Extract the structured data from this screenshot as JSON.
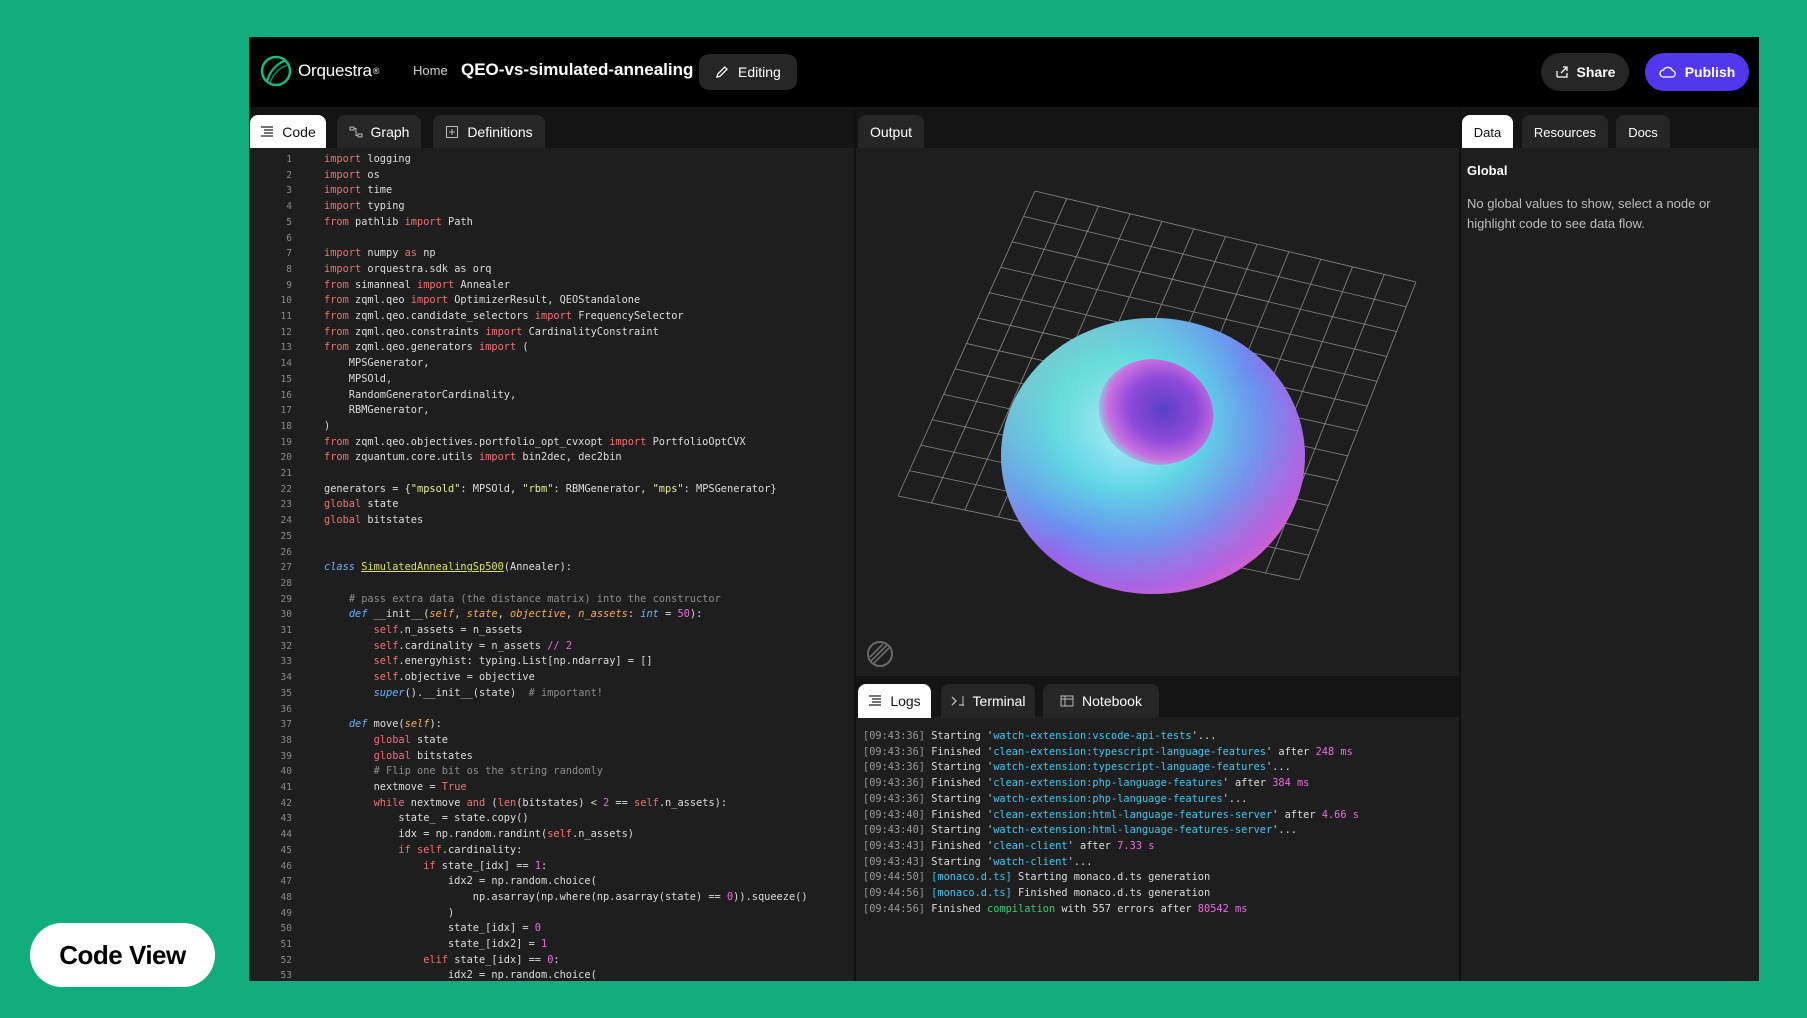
{
  "brand": {
    "name": "Orquestra",
    "mark": "®"
  },
  "header": {
    "home": "Home",
    "title": "QEO-vs-simulated-annealing",
    "edit_label": "Editing",
    "share_label": "Share",
    "publish_label": "Publish"
  },
  "code_tabs": [
    {
      "label": "Code",
      "active": true
    },
    {
      "label": "Graph",
      "active": false
    },
    {
      "label": "Definitions",
      "active": false
    }
  ],
  "output_tab": "Output",
  "data_tabs": [
    {
      "label": "Data",
      "active": true
    },
    {
      "label": "Resources",
      "active": false
    },
    {
      "label": "Docs",
      "active": false
    }
  ],
  "log_tabs": [
    {
      "label": "Logs",
      "active": true
    },
    {
      "label": "Terminal",
      "active": false
    },
    {
      "label": "Notebook",
      "active": false
    }
  ],
  "data_panel": {
    "title": "Global",
    "message": "No global values to show, select a node or highlight code to see data flow."
  },
  "code_lines": [
    [
      [
        "import",
        "k"
      ],
      [
        " logging",
        ""
      ]
    ],
    [
      [
        "import",
        "k"
      ],
      [
        " os",
        ""
      ]
    ],
    [
      [
        "import",
        "k"
      ],
      [
        " time",
        ""
      ]
    ],
    [
      [
        "import",
        "k"
      ],
      [
        " typing",
        ""
      ]
    ],
    [
      [
        "from",
        "k"
      ],
      [
        " pathlib ",
        ""
      ],
      [
        "import",
        "k"
      ],
      [
        " Path",
        ""
      ]
    ],
    [],
    [
      [
        "import",
        "k"
      ],
      [
        " numpy ",
        ""
      ],
      [
        "as",
        "k"
      ],
      [
        " np",
        ""
      ]
    ],
    [
      [
        "import",
        "k"
      ],
      [
        " orquestra.sdk as orq",
        ""
      ]
    ],
    [
      [
        "from",
        "k"
      ],
      [
        " simanneal ",
        ""
      ],
      [
        "import",
        "k"
      ],
      [
        " Annealer",
        ""
      ]
    ],
    [
      [
        "from",
        "k"
      ],
      [
        " zqml.qeo ",
        ""
      ],
      [
        "import",
        "k"
      ],
      [
        " OptimizerResult, QEOStandalone",
        ""
      ]
    ],
    [
      [
        "from",
        "k"
      ],
      [
        " zqml.qeo.candidate_selectors ",
        ""
      ],
      [
        "import",
        "k"
      ],
      [
        " FrequencySelector",
        ""
      ]
    ],
    [
      [
        "from",
        "k"
      ],
      [
        " zqml.qeo.constraints ",
        ""
      ],
      [
        "import",
        "k"
      ],
      [
        " CardinalityConstraint",
        ""
      ]
    ],
    [
      [
        "from",
        "k"
      ],
      [
        " zqml.qeo.generators ",
        ""
      ],
      [
        "import",
        "k"
      ],
      [
        " (",
        ""
      ]
    ],
    [
      [
        "    MPSGenerator,",
        ""
      ]
    ],
    [
      [
        "    MPSOld,",
        ""
      ]
    ],
    [
      [
        "    RandomGeneratorCardinality,",
        ""
      ]
    ],
    [
      [
        "    RBMGenerator,",
        ""
      ]
    ],
    [
      [
        ")",
        ""
      ]
    ],
    [
      [
        "from",
        "k"
      ],
      [
        " zqml.qeo.objectives.portfolio_opt_cvxopt ",
        ""
      ],
      [
        "import",
        "k"
      ],
      [
        " PortfolioOptCVX",
        ""
      ]
    ],
    [
      [
        "from",
        "k"
      ],
      [
        " zquantum.core.utils ",
        ""
      ],
      [
        "import",
        "k"
      ],
      [
        " bin2dec, dec2bin",
        ""
      ]
    ],
    [],
    [
      [
        "generators = {",
        ""
      ],
      [
        "\"mpsold\"",
        "s"
      ],
      [
        ": MPSOld, ",
        ""
      ],
      [
        "\"rbm\"",
        "s"
      ],
      [
        ": RBMGenerator, ",
        ""
      ],
      [
        "\"mps\"",
        "s"
      ],
      [
        ": MPSGenerator}",
        ""
      ]
    ],
    [
      [
        "global",
        "k"
      ],
      [
        " state",
        ""
      ]
    ],
    [
      [
        "global",
        "k"
      ],
      [
        " bitstates",
        ""
      ]
    ],
    [],
    [],
    [
      [
        "class",
        "kb"
      ],
      [
        " ",
        ""
      ],
      [
        "SimulatedAnnealingSp500",
        "cl"
      ],
      [
        "(Annealer):",
        ""
      ]
    ],
    [],
    [
      [
        "    ",
        ""
      ],
      [
        "# pass extra data (the distance matrix) into the constructor",
        "cm"
      ]
    ],
    [
      [
        "    ",
        ""
      ],
      [
        "def",
        "kb"
      ],
      [
        " __init__(",
        ""
      ],
      [
        "self",
        "pi"
      ],
      [
        ", ",
        ""
      ],
      [
        "state",
        "pi"
      ],
      [
        ", ",
        ""
      ],
      [
        "objective",
        "pi"
      ],
      [
        ", ",
        ""
      ],
      [
        "n_assets",
        "pi"
      ],
      [
        ": ",
        ""
      ],
      [
        "int",
        "kb"
      ],
      [
        " = ",
        ""
      ],
      [
        "50",
        "n"
      ],
      [
        "):",
        ""
      ]
    ],
    [
      [
        "        ",
        ""
      ],
      [
        "self",
        "k"
      ],
      [
        ".n_assets = n_assets",
        ""
      ]
    ],
    [
      [
        "        ",
        ""
      ],
      [
        "self",
        "k"
      ],
      [
        ".cardinality = n_assets ",
        ""
      ],
      [
        "// 2",
        "n"
      ]
    ],
    [
      [
        "        ",
        ""
      ],
      [
        "self",
        "k"
      ],
      [
        ".energyhist: typing.List[np.ndarray] = []",
        ""
      ]
    ],
    [
      [
        "        ",
        ""
      ],
      [
        "self",
        "k"
      ],
      [
        ".objective = objective",
        ""
      ]
    ],
    [
      [
        "        ",
        ""
      ],
      [
        "super",
        "kb"
      ],
      [
        "().__init__(state)  ",
        ""
      ],
      [
        "# important!",
        "cm"
      ]
    ],
    [],
    [
      [
        "    ",
        ""
      ],
      [
        "def",
        "kb"
      ],
      [
        " move(",
        ""
      ],
      [
        "self",
        "pi"
      ],
      [
        "):",
        ""
      ]
    ],
    [
      [
        "        ",
        ""
      ],
      [
        "global",
        "k"
      ],
      [
        " state",
        ""
      ]
    ],
    [
      [
        "        ",
        ""
      ],
      [
        "global",
        "k"
      ],
      [
        " bitstates",
        ""
      ]
    ],
    [
      [
        "        ",
        ""
      ],
      [
        "# Flip one bit os the string randomly",
        "cm"
      ]
    ],
    [
      [
        "        nextmove = ",
        ""
      ],
      [
        "True",
        "k"
      ]
    ],
    [
      [
        "        ",
        ""
      ],
      [
        "while",
        "k"
      ],
      [
        " nextmove ",
        ""
      ],
      [
        "and",
        "k"
      ],
      [
        " (",
        ""
      ],
      [
        "len",
        "k"
      ],
      [
        "(bitstates) < ",
        ""
      ],
      [
        "2",
        "n"
      ],
      [
        " == ",
        ""
      ],
      [
        "self",
        "k"
      ],
      [
        ".n_assets):",
        ""
      ]
    ],
    [
      [
        "            state_ = state.copy()",
        ""
      ]
    ],
    [
      [
        "            idx = np.random.randint(",
        ""
      ],
      [
        "self",
        "k"
      ],
      [
        ".n_assets)",
        ""
      ]
    ],
    [
      [
        "            ",
        ""
      ],
      [
        "if",
        "k"
      ],
      [
        " ",
        ""
      ],
      [
        "self",
        "k"
      ],
      [
        ".cardinality:",
        ""
      ]
    ],
    [
      [
        "                ",
        ""
      ],
      [
        "if",
        "k"
      ],
      [
        " state_[idx] == ",
        ""
      ],
      [
        "1",
        "n"
      ],
      [
        ":",
        ""
      ]
    ],
    [
      [
        "                    idx2 = np.random.choice(",
        ""
      ]
    ],
    [
      [
        "                        np.asarray(np.where(np.asarray(state) == ",
        ""
      ],
      [
        "0",
        "n"
      ],
      [
        ")).squeeze()",
        ""
      ]
    ],
    [
      [
        "                    )",
        ""
      ]
    ],
    [
      [
        "                    state_[idx] = ",
        ""
      ],
      [
        "0",
        "n"
      ]
    ],
    [
      [
        "                    state_[idx2] = ",
        ""
      ],
      [
        "1",
        "n"
      ]
    ],
    [
      [
        "                ",
        ""
      ],
      [
        "elif",
        "k"
      ],
      [
        " state_[idx] == ",
        ""
      ],
      [
        "0",
        "n"
      ],
      [
        ":",
        ""
      ]
    ],
    [
      [
        "                    idx2 = np.random.choice(",
        ""
      ]
    ]
  ],
  "log_lines": [
    [
      [
        "[09:43:36]",
        "lts"
      ],
      [
        " Starting '",
        ""
      ],
      [
        "watch-extension:vscode-api-tests",
        "lq"
      ],
      [
        "'...",
        ""
      ]
    ],
    [
      [
        "[09:43:36]",
        "lts"
      ],
      [
        " Finished '",
        ""
      ],
      [
        "clean-extension:typescript-language-features",
        "lq"
      ],
      [
        "' after ",
        ""
      ],
      [
        "248 ms",
        "lnum"
      ]
    ],
    [
      [
        "[09:43:36]",
        "lts"
      ],
      [
        " Starting '",
        ""
      ],
      [
        "watch-extension:typescript-language-features",
        "lq"
      ],
      [
        "'...",
        ""
      ]
    ],
    [
      [
        "[09:43:36]",
        "lts"
      ],
      [
        " Finished '",
        ""
      ],
      [
        "clean-extension:php-language-features",
        "lq"
      ],
      [
        "' after ",
        ""
      ],
      [
        "384 ms",
        "lnum"
      ]
    ],
    [
      [
        "[09:43:36]",
        "lts"
      ],
      [
        " Starting '",
        ""
      ],
      [
        "watch-extension:php-language-features",
        "lq"
      ],
      [
        "'...",
        ""
      ]
    ],
    [
      [
        "[09:43:40]",
        "lts"
      ],
      [
        " Finished '",
        ""
      ],
      [
        "clean-extension:html-language-features-server",
        "lq"
      ],
      [
        "' after ",
        ""
      ],
      [
        "4.66 s",
        "lnum"
      ]
    ],
    [
      [
        "[09:43:40]",
        "lts"
      ],
      [
        " Starting '",
        ""
      ],
      [
        "watch-extension:html-language-features-server",
        "lq"
      ],
      [
        "'...",
        ""
      ]
    ],
    [
      [
        "[09:43:43]",
        "lts"
      ],
      [
        " Finished '",
        ""
      ],
      [
        "clean-client",
        "lq"
      ],
      [
        "' after ",
        ""
      ],
      [
        "7.33 s",
        "lnum"
      ]
    ],
    [
      [
        "[09:43:43]",
        "lts"
      ],
      [
        " Starting '",
        ""
      ],
      [
        "watch-client",
        "lq"
      ],
      [
        "'...",
        ""
      ]
    ],
    [
      [
        "[09:44:50]",
        "lts"
      ],
      [
        " ",
        ""
      ],
      [
        "[monaco.d.ts]",
        "lq"
      ],
      [
        " Starting monaco.d.ts generation",
        ""
      ]
    ],
    [
      [
        "[09:44:56]",
        "lts"
      ],
      [
        " ",
        ""
      ],
      [
        "[monaco.d.ts]",
        "lq"
      ],
      [
        " Finished monaco.d.ts generation",
        ""
      ]
    ],
    [
      [
        "[09:44:56]",
        "lts"
      ],
      [
        " Finished ",
        ""
      ],
      [
        "compilation",
        "lgr"
      ],
      [
        " with 557 errors after ",
        ""
      ],
      [
        "80542 ms",
        "lnum"
      ]
    ]
  ],
  "badge_label": "Code View",
  "colors": {
    "background": "#12ad7c",
    "publish": "#5138ec",
    "keyword": "#f07078",
    "string": "#e8ee8c"
  }
}
